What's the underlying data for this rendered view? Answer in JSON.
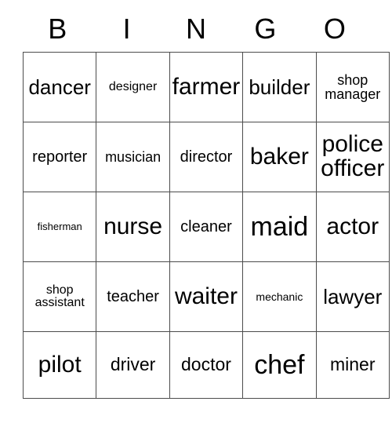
{
  "card": {
    "title": "BINGO",
    "header_letters": [
      "B",
      "I",
      "N",
      "G",
      "O"
    ],
    "grid_colors": {
      "border": "#4c4c4c",
      "background": "#ffffff",
      "text": "#000000"
    },
    "rows": [
      [
        {
          "label": "dancer",
          "size": "fs-xl"
        },
        {
          "label": "designer",
          "size": "fs-sm"
        },
        {
          "label": "farmer",
          "size": "fs-xxl"
        },
        {
          "label": "builder",
          "size": "fs-xl"
        },
        {
          "label": "shop manager",
          "size": "fs-m"
        }
      ],
      [
        {
          "label": "reporter",
          "size": "fs-ml"
        },
        {
          "label": "musician",
          "size": "fs-m"
        },
        {
          "label": "director",
          "size": "fs-ml"
        },
        {
          "label": "baker",
          "size": "fs-xxl"
        },
        {
          "label": "police officer",
          "size": "fs-xxl"
        }
      ],
      [
        {
          "label": "fisherman",
          "size": "fs-xs"
        },
        {
          "label": "nurse",
          "size": "fs-xxl"
        },
        {
          "label": "cleaner",
          "size": "fs-ml"
        },
        {
          "label": "maid",
          "size": "fs-3xl"
        },
        {
          "label": "actor",
          "size": "fs-xxl"
        }
      ],
      [
        {
          "label": "shop assistant",
          "size": "fs-sm"
        },
        {
          "label": "teacher",
          "size": "fs-ml"
        },
        {
          "label": "waiter",
          "size": "fs-xxl"
        },
        {
          "label": "mechanic",
          "size": "fs-s"
        },
        {
          "label": "lawyer",
          "size": "fs-xl"
        }
      ],
      [
        {
          "label": "pilot",
          "size": "fs-xxl"
        },
        {
          "label": "driver",
          "size": "fs-l"
        },
        {
          "label": "doctor",
          "size": "fs-l"
        },
        {
          "label": "chef",
          "size": "fs-3xl"
        },
        {
          "label": "miner",
          "size": "fs-l"
        }
      ]
    ]
  }
}
